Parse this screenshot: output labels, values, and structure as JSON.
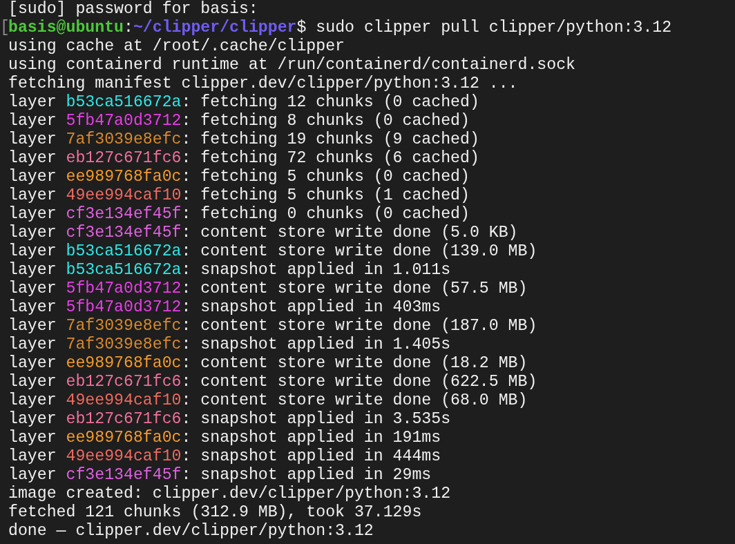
{
  "terminal": {
    "lines": [
      {
        "kind": "text",
        "text": "[sudo] password for basis:"
      },
      {
        "kind": "prompt",
        "marker": "[",
        "user_host": "basis@ubuntu",
        "separator": ":",
        "path": "~/clipper/clipper",
        "symbol": "$",
        "command": "sudo clipper pull clipper/python:3.12"
      },
      {
        "kind": "text",
        "text": "using cache at /root/.cache/clipper"
      },
      {
        "kind": "text",
        "text": "using containerd runtime at /run/containerd/containerd.sock"
      },
      {
        "kind": "text",
        "text": "fetching manifest clipper.dev/clipper/python:3.12 ..."
      },
      {
        "kind": "layer",
        "prefix": "layer",
        "id": "b53ca516672a",
        "color": "#2ee6e6",
        "message": ": fetching 12 chunks (0 cached)"
      },
      {
        "kind": "layer",
        "prefix": "layer",
        "id": "5fb47a0d3712",
        "color": "#e83ee8",
        "message": ": fetching 8 chunks (0 cached)"
      },
      {
        "kind": "layer",
        "prefix": "layer",
        "id": "7af3039e8efc",
        "color": "#d98a2b",
        "message": ": fetching 19 chunks (9 cached)"
      },
      {
        "kind": "layer",
        "prefix": "layer",
        "id": "eb127c671fc6",
        "color": "#f0709a",
        "message": ": fetching 72 chunks (6 cached)"
      },
      {
        "kind": "layer",
        "prefix": "layer",
        "id": "ee989768fa0c",
        "color": "#f59a2a",
        "message": ": fetching 5 chunks (0 cached)"
      },
      {
        "kind": "layer",
        "prefix": "layer",
        "id": "49ee994caf10",
        "color": "#f06a60",
        "message": ": fetching 5 chunks (1 cached)"
      },
      {
        "kind": "layer",
        "prefix": "layer",
        "id": "cf3e134ef45f",
        "color": "#e060e0",
        "message": ": fetching 0 chunks (0 cached)"
      },
      {
        "kind": "layer",
        "prefix": "layer",
        "id": "cf3e134ef45f",
        "color": "#e060e0",
        "message": ": content store write done (5.0 KB)"
      },
      {
        "kind": "layer",
        "prefix": "layer",
        "id": "b53ca516672a",
        "color": "#2ee6e6",
        "message": ": content store write done (139.0 MB)"
      },
      {
        "kind": "layer",
        "prefix": "layer",
        "id": "b53ca516672a",
        "color": "#2ee6e6",
        "message": ": snapshot applied in 1.011s"
      },
      {
        "kind": "layer",
        "prefix": "layer",
        "id": "5fb47a0d3712",
        "color": "#e83ee8",
        "message": ": content store write done (57.5 MB)"
      },
      {
        "kind": "layer",
        "prefix": "layer",
        "id": "5fb47a0d3712",
        "color": "#e83ee8",
        "message": ": snapshot applied in 403ms"
      },
      {
        "kind": "layer",
        "prefix": "layer",
        "id": "7af3039e8efc",
        "color": "#d98a2b",
        "message": ": content store write done (187.0 MB)"
      },
      {
        "kind": "layer",
        "prefix": "layer",
        "id": "7af3039e8efc",
        "color": "#d98a2b",
        "message": ": snapshot applied in 1.405s"
      },
      {
        "kind": "layer",
        "prefix": "layer",
        "id": "ee989768fa0c",
        "color": "#f59a2a",
        "message": ": content store write done (18.2 MB)"
      },
      {
        "kind": "layer",
        "prefix": "layer",
        "id": "eb127c671fc6",
        "color": "#f0709a",
        "message": ": content store write done (622.5 MB)"
      },
      {
        "kind": "layer",
        "prefix": "layer",
        "id": "49ee994caf10",
        "color": "#f06a60",
        "message": ": content store write done (68.0 MB)"
      },
      {
        "kind": "layer",
        "prefix": "layer",
        "id": "eb127c671fc6",
        "color": "#f0709a",
        "message": ": snapshot applied in 3.535s"
      },
      {
        "kind": "layer",
        "prefix": "layer",
        "id": "ee989768fa0c",
        "color": "#f59a2a",
        "message": ": snapshot applied in 191ms"
      },
      {
        "kind": "layer",
        "prefix": "layer",
        "id": "49ee994caf10",
        "color": "#f06a60",
        "message": ": snapshot applied in 444ms"
      },
      {
        "kind": "layer",
        "prefix": "layer",
        "id": "cf3e134ef45f",
        "color": "#e060e0",
        "message": ": snapshot applied in 29ms"
      },
      {
        "kind": "text",
        "text": "image created: clipper.dev/clipper/python:3.12"
      },
      {
        "kind": "text",
        "text": "fetched 121 chunks (312.9 MB), took 37.129s"
      },
      {
        "kind": "text",
        "text": "done — clipper.dev/clipper/python:3.12"
      }
    ]
  }
}
